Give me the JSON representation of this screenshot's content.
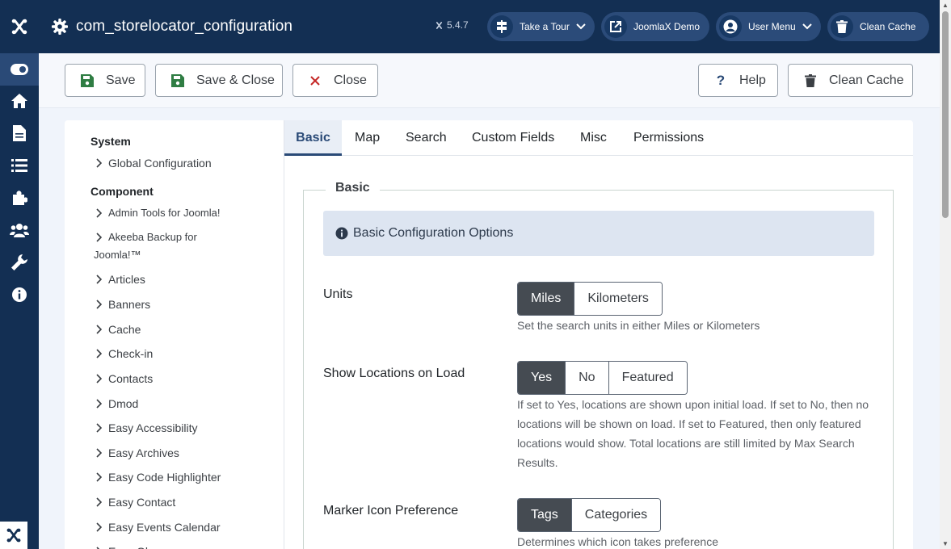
{
  "app": {
    "title": "com_storelocator_configuration",
    "version": "5.4.7"
  },
  "header_buttons": {
    "tour": "Take a Tour",
    "demo": "JoomlaX Demo",
    "user_menu": "User Menu",
    "clean_cache": "Clean Cache"
  },
  "toolbar": {
    "save": "Save",
    "save_close": "Save & Close",
    "close": "Close",
    "help": "Help",
    "clean_cache": "Clean Cache"
  },
  "sidebar": {
    "system_heading": "System",
    "system_items": [
      "Global Configuration"
    ],
    "component_heading": "Component",
    "component_items": [
      "Admin Tools for Joomla!",
      "Akeeba Backup for",
      "Joomla!™",
      "Articles",
      "Banners",
      "Cache",
      "Check-in",
      "Contacts",
      "Dmod",
      "Easy Accessibility",
      "Easy Archives",
      "Easy Code Highlighter",
      "Easy Contact",
      "Easy Events Calendar",
      "Easy Gl"
    ]
  },
  "tabs": [
    "Basic",
    "Map",
    "Search",
    "Custom Fields",
    "Misc",
    "Permissions"
  ],
  "active_tab": "Basic",
  "fieldset": {
    "legend": "Basic",
    "info": "Basic Configuration Options"
  },
  "fields": {
    "units": {
      "label": "Units",
      "options": [
        "Miles",
        "Kilometers"
      ],
      "selected": "Miles",
      "help": "Set the search units in either Miles or Kilometers"
    },
    "show_locations": {
      "label": "Show Locations on Load",
      "options": [
        "Yes",
        "No",
        "Featured"
      ],
      "selected": "Yes",
      "help_lines": [
        "If set to Yes, locations are shown upon initial load. If set to No, then no",
        "locations will be shown on load. If set to Featured, then only featured",
        "locations would show. Total locations are still limited by Max Search",
        "Results."
      ]
    },
    "marker_icon": {
      "label": "Marker Icon Preference",
      "options": [
        "Tags",
        "Categories"
      ],
      "selected": "Tags",
      "help": "Determines which icon takes preference"
    }
  },
  "colors": {
    "header_bg": "#132f53",
    "accent": "#2a4a77",
    "save_green": "#2f7d43",
    "close_red": "#c52827"
  }
}
